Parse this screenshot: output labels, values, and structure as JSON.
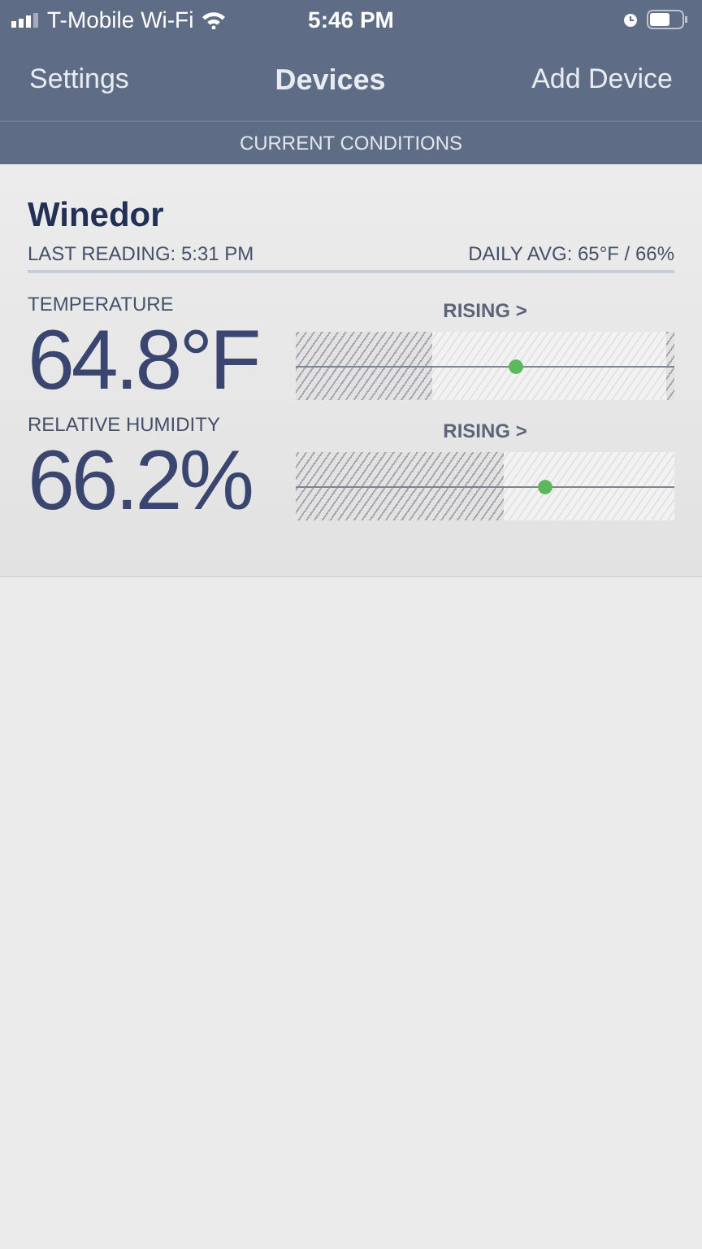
{
  "status_bar": {
    "carrier": "T-Mobile Wi-Fi",
    "time": "5:46 PM"
  },
  "nav": {
    "left": "Settings",
    "title": "Devices",
    "right": "Add Device"
  },
  "section_header": "CURRENT CONDITIONS",
  "device": {
    "name": "Winedor",
    "last_reading": "LAST READING: 5:31 PM",
    "daily_avg": "DAILY AVG: 65°F / 66%",
    "metrics": [
      {
        "label": "TEMPERATURE",
        "value": "64.8°F",
        "trend": "RISING >",
        "marker": {
          "level": 0.58
        },
        "low_band": {
          "level": 0.36
        },
        "high_band": {
          "level": 0.02
        }
      },
      {
        "label": "RELATIVE HUMIDITY",
        "value": "66.2%",
        "trend": "RISING >",
        "marker": {
          "level": 0.66
        },
        "low_band": {
          "level": 0.55
        }
      }
    ]
  }
}
